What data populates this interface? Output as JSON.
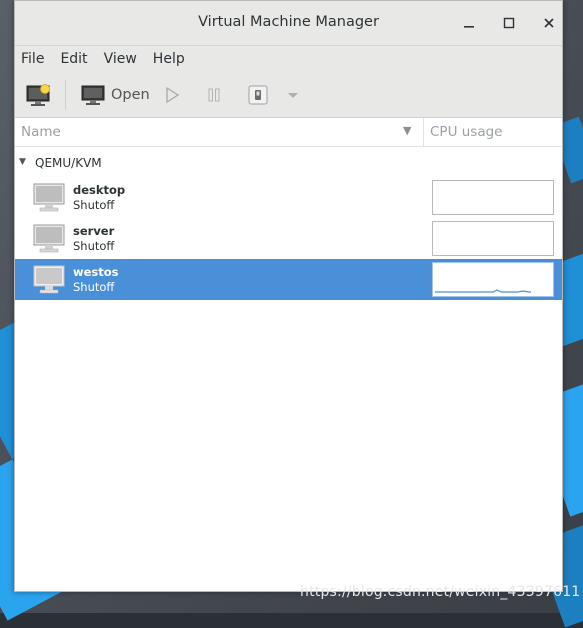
{
  "window": {
    "title": "Virtual Machine Manager",
    "controls": [
      "minimize-icon",
      "maximize-icon",
      "close-icon"
    ]
  },
  "menu": [
    "File",
    "Edit",
    "View",
    "Help"
  ],
  "toolbar": {
    "open_label": "Open"
  },
  "list": {
    "col_name": "Name",
    "col_cpu": "CPU usage",
    "group": "QEMU/KVM",
    "vms": [
      {
        "name": "desktop",
        "status": "Shutoff",
        "selected": false
      },
      {
        "name": "server",
        "status": "Shutoff",
        "selected": false
      },
      {
        "name": "westos",
        "status": "Shutoff",
        "selected": true
      }
    ]
  },
  "colors": {
    "selection": "#4a90d9",
    "graph_line": "#4a90d9"
  },
  "watermark": "https://blog.csdn.net/weixin_43397611"
}
